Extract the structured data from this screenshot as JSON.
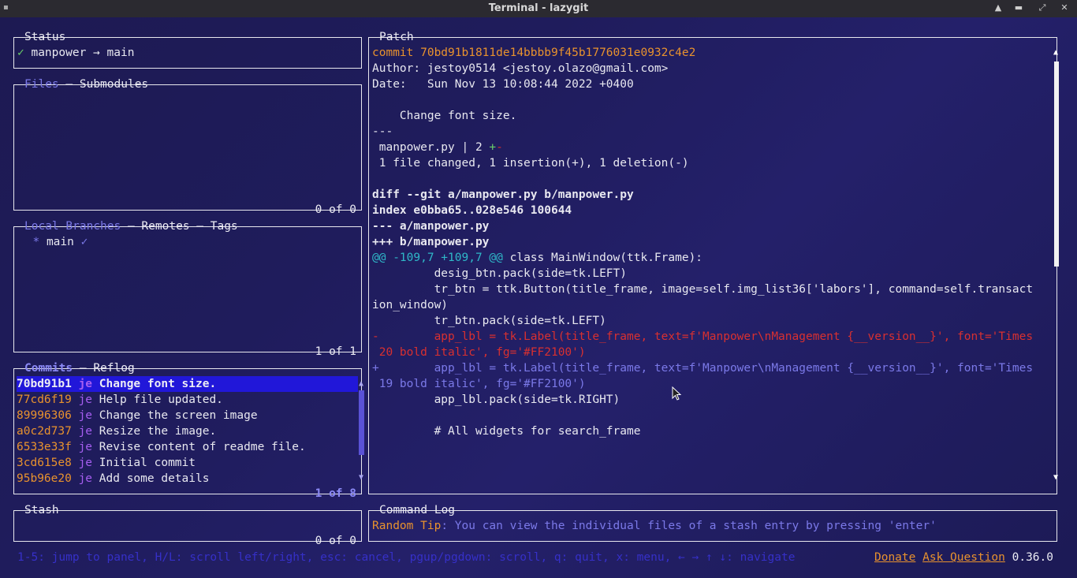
{
  "window": {
    "title": "Terminal - lazygit"
  },
  "status": {
    "title": "Status",
    "check": "✓",
    "repo": "manpower",
    "arrow": "→",
    "branch": "main"
  },
  "files": {
    "title_active": "Files",
    "sep": " – ",
    "title_other": "Submodules",
    "footer": "0 of 0"
  },
  "branches": {
    "title_active": "Local Branches",
    "sep1": " – ",
    "tab2": "Remotes",
    "sep2": " – ",
    "tab3": "Tags",
    "items": [
      {
        "marker": "*",
        "name": "main",
        "check": "✓"
      }
    ],
    "footer": "1 of 1"
  },
  "commits": {
    "title_active": "Commits",
    "sep": " – ",
    "title_other": "Reflog",
    "rows": [
      {
        "hash": "70bd91b1",
        "author": "je",
        "msg": "Change font size."
      },
      {
        "hash": "77cd6f19",
        "author": "je",
        "msg": "Help file updated."
      },
      {
        "hash": "89996306",
        "author": "je",
        "msg": "Change the screen image"
      },
      {
        "hash": "a0c2d737",
        "author": "je",
        "msg": "Resize the image."
      },
      {
        "hash": "6533e33f",
        "author": "je",
        "msg": "Revise content of readme file."
      },
      {
        "hash": "3cd615e8",
        "author": "je",
        "msg": "Initial commit"
      },
      {
        "hash": "95b96e20",
        "author": "je",
        "msg": "Add some details"
      }
    ],
    "footer": "1 of 8"
  },
  "stash": {
    "title": "Stash",
    "footer": "0 of 0"
  },
  "patch": {
    "title": "Patch",
    "commit_line": "commit 70bd91b1811de14bbbb9f45b1776031e0932c4e2",
    "author_line": "Author: jestoy0514 <jestoy.olazo@gmail.com>",
    "date_line": "Date:   Sun Nov 13 10:08:44 2022 +0400",
    "message": "    Change font size.",
    "sep": "---",
    "stat_file": " manpower.py | 2 ",
    "stat_plus": "+",
    "stat_minus": "-",
    "stat_summary": " 1 file changed, 1 insertion(+), 1 deletion(-)",
    "diff_header": "diff --git a/manpower.py b/manpower.py",
    "index_line": "index e0bba65..028e546 100644",
    "minus_file": "--- a/manpower.py",
    "plus_file": "+++ b/manpower.py",
    "hunk": "@@ -109,7 +109,7 @@",
    "hunk_ctx": " class MainWindow(ttk.Frame):",
    "ctx1": "         desig_btn.pack(side=tk.LEFT)",
    "ctx2": "         tr_btn = ttk.Button(title_frame, image=self.img_list36['labors'], command=self.transact",
    "ctx2b": "ion_window)",
    "ctx3": "         tr_btn.pack(side=tk.LEFT)",
    "del_sign": "-",
    "del_line": "        app_lbl = tk.Label(title_frame, text=f'Manpower\\nManagement {__version__}', font='Times",
    "del_line2": " 20 bold italic', fg='#FF2100')",
    "add_sign": "+",
    "add_line": "        app_lbl = tk.Label(title_frame, text=f'Manpower\\nManagement {__version__}', font='Times",
    "add_line2": " 19 bold italic', fg='#FF2100')",
    "ctx4": "         app_lbl.pack(side=tk.RIGHT)",
    "ctx5": "         # All widgets for search_frame"
  },
  "command_log": {
    "title": "Command Log",
    "tip_label": "Random Tip",
    "tip_text": ": You can view the individual files of a stash entry by pressing 'enter'"
  },
  "footer": {
    "keybindings": "1-5: jump to panel, H/L: scroll left/right, esc: cancel, pgup/pgdown: scroll, q: quit, x: menu, ← → ↑ ↓: navigate",
    "donate": "Donate",
    "ask": "Ask Question",
    "version": "0.36.0"
  },
  "colors": {
    "accent": "#7b79e8",
    "selection": "#2117d9",
    "hash_recent": "#e8922e",
    "hash_head": "#ffffff",
    "added": "#6ad06a",
    "deleted": "#d83030",
    "hunk": "#2fb8c8"
  }
}
